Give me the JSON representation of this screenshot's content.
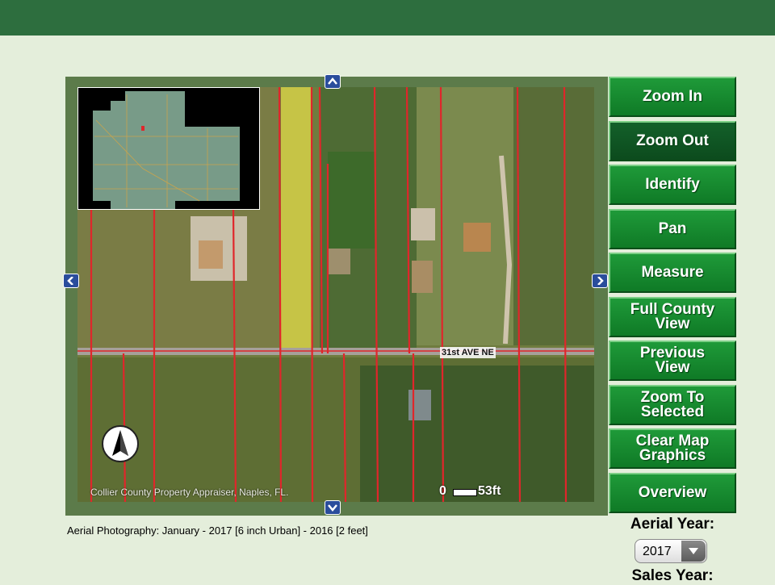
{
  "header": {
    "title": ""
  },
  "map": {
    "road_label": "31st AVE NE",
    "credit": "Collier County Property Appraiser, Naples, FL.",
    "scale_zero": "0",
    "scale_label": "53ft",
    "caption": "Aerial Photography: January - 2017 [6 inch Urban] - 2016 [2 feet]"
  },
  "tools": [
    {
      "label": "Zoom In",
      "active": false
    },
    {
      "label": "Zoom Out",
      "active": true
    },
    {
      "label": "Identify",
      "active": false
    },
    {
      "label": "Pan",
      "active": false
    },
    {
      "label": "Measure",
      "active": false
    },
    {
      "label": "Full County\nView",
      "active": false
    },
    {
      "label": "Previous\nView",
      "active": false
    },
    {
      "label": "Zoom To\nSelected",
      "active": false
    },
    {
      "label": "Clear Map\nGraphics",
      "active": false
    },
    {
      "label": "Overview",
      "active": false
    }
  ],
  "aerial_year": {
    "title": "Aerial Year:",
    "selected": "2017"
  },
  "sales_year": {
    "title": "Sales Year:"
  },
  "icons": {
    "pan_up": "chevron-up-icon",
    "pan_down": "chevron-down-icon",
    "pan_left": "chevron-left-icon",
    "pan_right": "chevron-right-icon",
    "north_arrow": "north-arrow-icon"
  },
  "colors": {
    "header_green": "#2d6e3e",
    "button_green": "#1a8f33",
    "button_active": "#13602a",
    "parcel_line": "#e0262b",
    "selected_parcel": "#e8e14a",
    "page_bg": "#e4eedb"
  }
}
